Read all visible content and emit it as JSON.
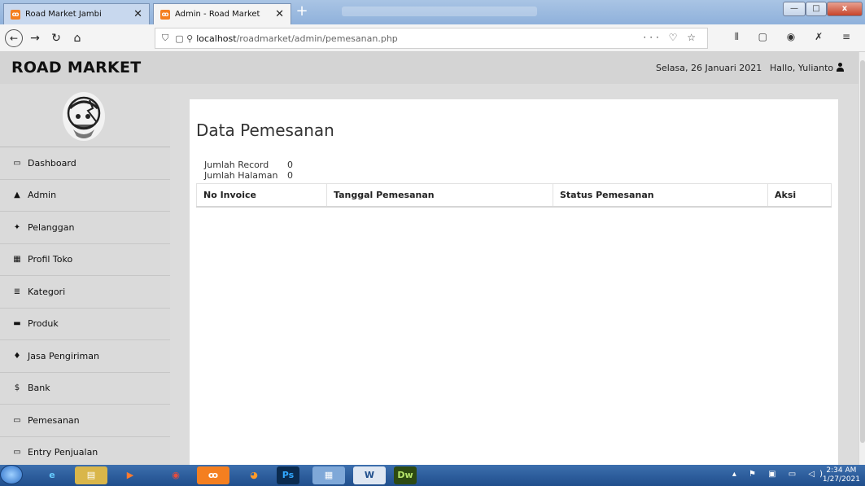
{
  "browser": {
    "tabs": [
      {
        "title": "Road Market Jambi",
        "active": false
      },
      {
        "title": "Admin - Road Market",
        "active": true
      }
    ],
    "new_tab": "+",
    "window_controls": {
      "minimize": "—",
      "maximize": "□",
      "close": "x"
    },
    "url": {
      "host": "localhost",
      "path": "/roadmarket/admin/pemesanan.php"
    },
    "url_actions": "··· ♡ ☆",
    "toolbar_icons": [
      "library-icon",
      "sidebar-icon",
      "account-icon",
      "extension-icon",
      "menu-icon"
    ]
  },
  "header": {
    "brand": "ROAD MARKET",
    "date": "Selasa, 26 Januari 2021",
    "greeting": "Hallo, Yulianto"
  },
  "sidebar": {
    "items": [
      {
        "label": "Dashboard",
        "icon": "desktop-icon",
        "glyph": "▭"
      },
      {
        "label": "Admin",
        "icon": "user-icon",
        "glyph": "▲"
      },
      {
        "label": "Pelanggan",
        "icon": "users-icon",
        "glyph": "✦"
      },
      {
        "label": "Profil Toko",
        "icon": "table-icon",
        "glyph": "▦"
      },
      {
        "label": "Kategori",
        "icon": "list-icon",
        "glyph": "≣"
      },
      {
        "label": "Produk",
        "icon": "briefcase-icon",
        "glyph": "▬"
      },
      {
        "label": "Jasa Pengiriman",
        "icon": "map-marker-icon",
        "glyph": "♦"
      },
      {
        "label": "Bank",
        "icon": "dollar-icon",
        "glyph": "$"
      },
      {
        "label": "Pemesanan",
        "icon": "credit-card-icon",
        "glyph": "▭"
      },
      {
        "label": "Entry Penjualan",
        "icon": "credit-card-icon",
        "glyph": "▭"
      }
    ]
  },
  "main": {
    "title": "Data Pemesanan",
    "stats": {
      "record_label": "Jumlah Record",
      "record_value": "0",
      "page_label": "Jumlah Halaman",
      "page_value": "0"
    },
    "table": {
      "headers": [
        "No Invoice",
        "Tanggal Pemesanan",
        "Status Pemesanan",
        "Aksi"
      ],
      "rows": []
    }
  },
  "taskbar": {
    "apps": [
      "Ps",
      "Dw"
    ],
    "time": "2:34 AM",
    "date": "1/27/2021"
  }
}
